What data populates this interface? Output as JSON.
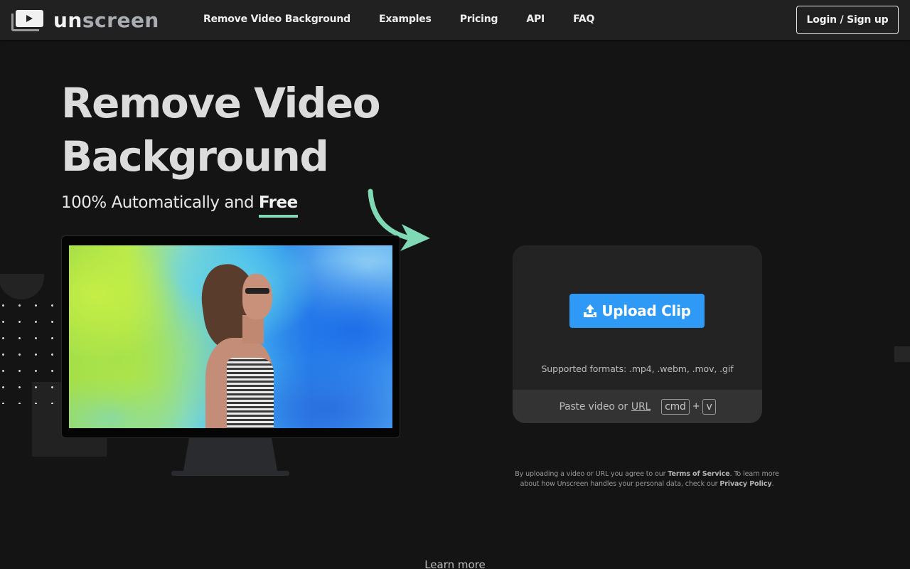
{
  "header": {
    "logo": {
      "text_part1": "un",
      "text_part2": "screen",
      "icon": "video-stack-logo-icon"
    },
    "nav": [
      {
        "label": "Remove Video Background"
      },
      {
        "label": "Examples"
      },
      {
        "label": "Pricing"
      },
      {
        "label": "API"
      },
      {
        "label": "FAQ"
      }
    ],
    "login_label": "Login / Sign up"
  },
  "hero": {
    "title_line1": "Remove Video",
    "title_line2": "Background",
    "subtitle_prefix": "100% Automatically and ",
    "subtitle_emphasis": "Free",
    "accent_color": "#7fd9b5"
  },
  "upload": {
    "button_label": "Upload Clip",
    "button_icon": "upload-icon",
    "button_color": "#2f9af5",
    "formats_text": "Supported formats: .mp4, .webm, .mov, .gif",
    "paste_prefix": "Paste video or",
    "paste_link": "URL",
    "shortcut_key1": "cmd",
    "shortcut_plus": "+",
    "shortcut_key2": "v"
  },
  "legal": {
    "part1": "By uploading a video or URL you agree to our ",
    "terms_link": "Terms of Service",
    "part2": ". To learn more about how Unscreen handles your personal data, check our ",
    "privacy_link": "Privacy Policy",
    "part3": "."
  },
  "footer": {
    "learn_more": "Learn more"
  }
}
